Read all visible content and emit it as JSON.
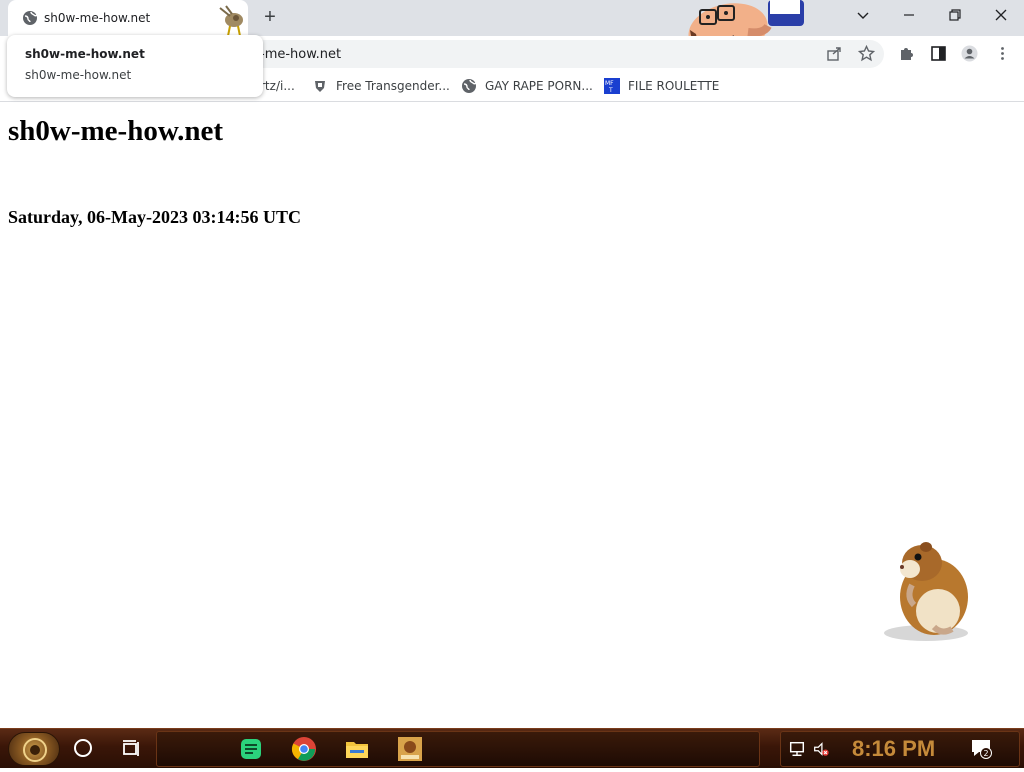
{
  "browser": {
    "tab": {
      "title": "sh0w-me-how.net",
      "favicon": "globe-icon"
    },
    "hover_card": {
      "title": "sh0w-me-how.net",
      "domain": "sh0w-me-how.net"
    },
    "new_tab": "+",
    "omnibox": {
      "visible_text": "-me-how.net"
    },
    "toolbar_icons": [
      "share-icon",
      "bookmark-star-icon",
      "extensions-icon",
      "side-panel-icon",
      "profile-icon",
      "menu-icon"
    ],
    "window_controls": [
      "tab-search-chevron-icon",
      "minimize-icon",
      "restore-icon",
      "close-icon"
    ]
  },
  "bookmarks": [
    {
      "label": "rtz/i...",
      "icon": ""
    },
    {
      "label": "Free Transgender...",
      "icon": "site-icon"
    },
    {
      "label": "GAY RAPE PORN...",
      "icon": "globe-icon"
    },
    {
      "label": "FILE ROULETTE",
      "icon": "mft-icon"
    }
  ],
  "page": {
    "heading": "sh0w-me-how.net",
    "datetime": "Saturday, 06-May-2023 03:14:56 UTC"
  },
  "taskbar": {
    "pinned": [
      "notes-app-icon",
      "chrome-icon",
      "file-explorer-icon",
      "game-app-icon"
    ],
    "clock": "8:16 PM",
    "notification_count": "2"
  }
}
